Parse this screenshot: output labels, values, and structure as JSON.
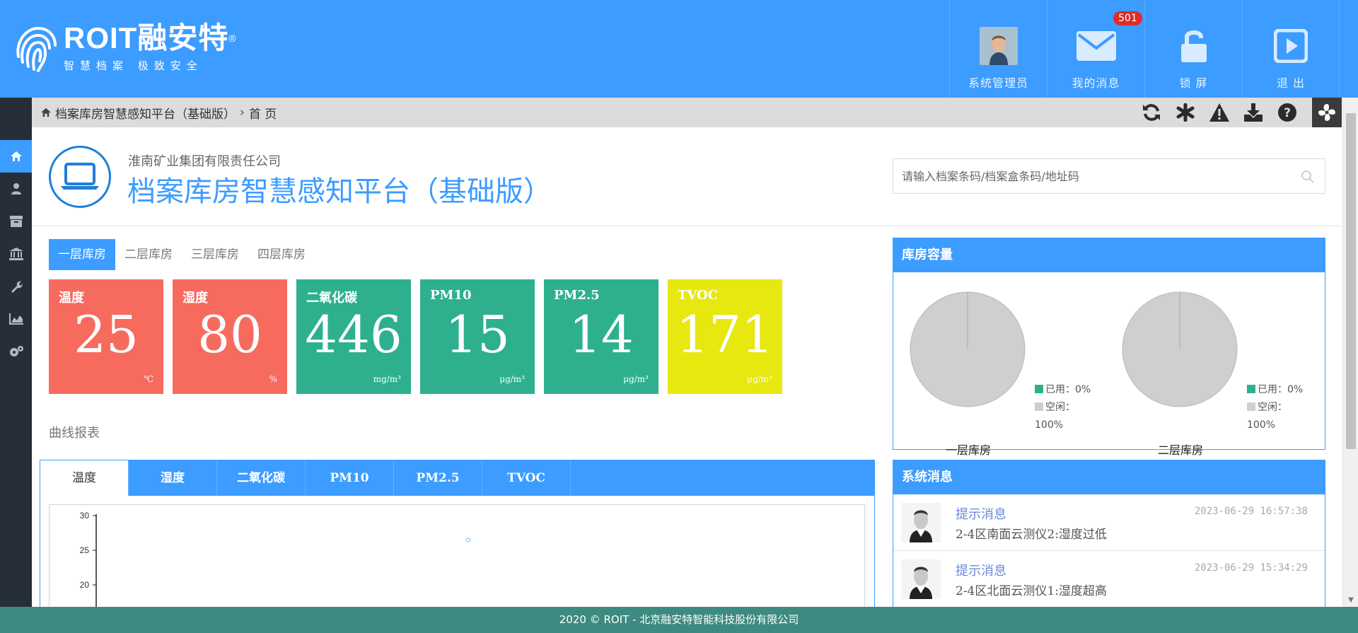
{
  "header": {
    "logo_brand": "ROIT融安特",
    "logo_registered": "®",
    "logo_slogan": "智慧档案  极致安全",
    "items": [
      {
        "label": "系统管理员",
        "icon": "admin-avatar"
      },
      {
        "label": "我的消息",
        "icon": "envelope-icon",
        "badge": "501"
      },
      {
        "label": "锁 屏",
        "icon": "unlock-icon"
      },
      {
        "label": "退 出",
        "icon": "exit-icon"
      }
    ],
    "color": "#3c9cff"
  },
  "sidebar": {
    "items": [
      "home-icon",
      "user-icon",
      "archive-box-icon",
      "bank-icon",
      "wrench-icon",
      "chart-icon",
      "gears-icon"
    ]
  },
  "breadcrumb": {
    "root": "档案库房智慧感知平台（基础版）",
    "current": "首 页"
  },
  "toolbar": {
    "icons": [
      "refresh-icon",
      "asterisk-icon",
      "warning-icon",
      "download-icon",
      "help-icon",
      "fan-icon"
    ]
  },
  "page": {
    "company": "淮南矿业集团有限责任公司",
    "title": "档案库房智慧感知平台（基础版）",
    "search_placeholder": "请输入档案条码/档案盒条码/地址码"
  },
  "floor_tabs": [
    "一层库房",
    "二层库房",
    "三层库房",
    "四层库房"
  ],
  "sensors": [
    {
      "label": "温度",
      "value": "25",
      "unit": "℃",
      "color": "#f76b5f"
    },
    {
      "label": "湿度",
      "value": "80",
      "unit": "%",
      "color": "#f76b5f"
    },
    {
      "label": "二氧化碳",
      "value": "446",
      "unit": "mg/m³",
      "color": "#2eb08f"
    },
    {
      "label": "PM10",
      "value": "15",
      "unit": "μg/m³",
      "color": "#2eb08f"
    },
    {
      "label": "PM2.5",
      "value": "14",
      "unit": "μg/m³",
      "color": "#2eb08f"
    },
    {
      "label": "TVOC",
      "value": "171",
      "unit": "μg/m³",
      "color": "#e6e80f"
    }
  ],
  "curve": {
    "title": "曲线报表",
    "tabs": [
      "温度",
      "湿度",
      "二氧化碳",
      "PM10",
      "PM2.5",
      "TVOC"
    ]
  },
  "chart_data": {
    "type": "line",
    "yticks": [
      "30",
      "25",
      "20"
    ],
    "ylim": [
      20,
      30
    ],
    "series": [
      {
        "values": [
          26.5
        ]
      }
    ]
  },
  "capacity": {
    "title": "库房容量",
    "pies": [
      {
        "name": "一层库房",
        "used_label": "已用：0%",
        "free_label": "空闲：100%",
        "used": 0,
        "free": 100
      },
      {
        "name": "二层库房",
        "used_label": "已用：0%",
        "free_label": "空闲：100%",
        "used": 0,
        "free": 100
      }
    ],
    "used_color": "#2eb08f",
    "free_color": "#cfcfcf"
  },
  "messages": {
    "title": "系统消息",
    "items": [
      {
        "title": "提示消息",
        "time": "2023-06-29 16:57:38",
        "text": "2-4区南面云测仪2:湿度过低"
      },
      {
        "title": "提示消息",
        "time": "2023-06-29 15:34:29",
        "text": "2-4区北面云测仪1:湿度超高"
      }
    ]
  },
  "footer": {
    "text": "2020 © ROIT - 北京融安特智能科技股份有限公司"
  }
}
